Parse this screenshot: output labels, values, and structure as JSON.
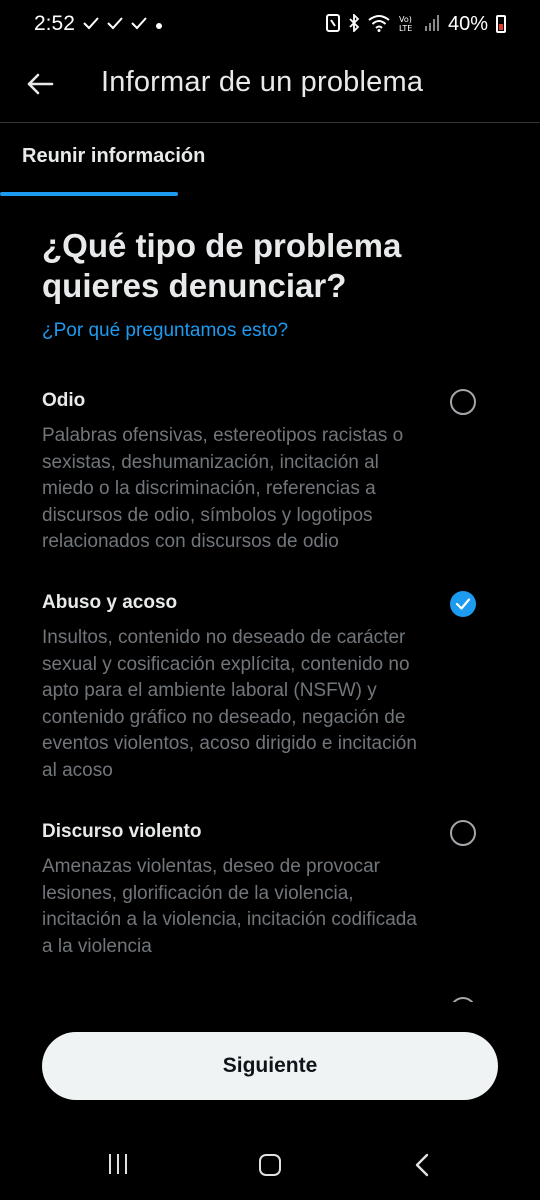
{
  "status_bar": {
    "time": "2:52",
    "notification_icons": [
      "check-icon",
      "check-icon",
      "check-icon",
      "dot-icon"
    ],
    "right_icons": [
      "nfc-icon",
      "bluetooth-icon",
      "wifi-icon",
      "volte-icon",
      "signal-icon"
    ],
    "volte_label": "Vo)\nLTE",
    "battery_percent": "40%"
  },
  "header": {
    "title": "Informar de un problema"
  },
  "tabs": [
    {
      "label": "Reunir información",
      "active": true
    }
  ],
  "main": {
    "question": "¿Qué tipo de problema quieres denunciar?",
    "why_link": "¿Por qué preguntamos esto?",
    "options": [
      {
        "title": "Odio",
        "description": "Palabras ofensivas, estereotipos racistas o sexistas, deshumanización, incitación al miedo o la discriminación, referencias a discursos de odio, símbolos y logotipos relacionados con discursos de odio",
        "selected": false
      },
      {
        "title": "Abuso y acoso",
        "description": "Insultos, contenido no deseado de carácter sexual y cosificación explícita, contenido no apto para el ambiente laboral (NSFW) y contenido gráfico no deseado, negación de eventos violentos, acoso dirigido e incitación al acoso",
        "selected": true
      },
      {
        "title": "Discurso violento",
        "description": "Amenazas violentas, deseo de provocar lesiones, glorificación de la violencia, incitación a la violencia, incitación codificada a la violencia",
        "selected": false
      }
    ]
  },
  "footer": {
    "next_label": "Siguiente"
  },
  "colors": {
    "accent": "#1d9bf0",
    "background": "#000000",
    "button_bg": "#eff3f4",
    "secondary_text": "#71767b"
  }
}
